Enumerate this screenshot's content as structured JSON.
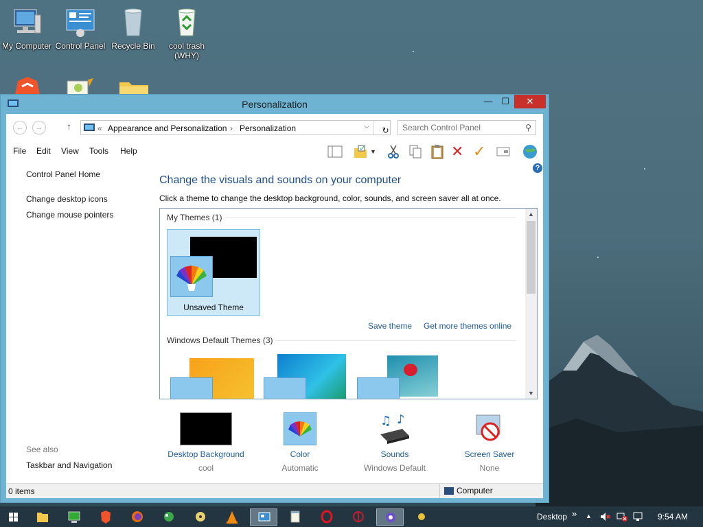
{
  "desktop": {
    "icons": [
      {
        "label": "My Computer"
      },
      {
        "label": "Control Panel"
      },
      {
        "label": "Recycle Bin"
      },
      {
        "label": "cool trash (WHY)"
      }
    ]
  },
  "window": {
    "title": "Personalization",
    "controls": {
      "minimize": "—",
      "maximize": "☐",
      "close": "✕"
    },
    "address": {
      "prefix": "«",
      "crumb1": "Appearance and Personalization",
      "sep": "›",
      "crumb2": "Personalization"
    },
    "search": {
      "placeholder": "Search Control Panel"
    },
    "menu": [
      "File",
      "Edit",
      "View",
      "Tools",
      "Help"
    ],
    "sidebar": {
      "home": "Control Panel Home",
      "links": [
        "Change desktop icons",
        "Change mouse pointers"
      ],
      "see_also": "See also",
      "see_also_links": [
        "Taskbar and Navigation"
      ]
    },
    "main": {
      "heading": "Change the visuals and sounds on your computer",
      "description": "Click a theme to change the desktop background, color, sounds, and screen saver all at once.",
      "my_themes_label": "My Themes (1)",
      "selected_theme": "Unsaved Theme",
      "save_theme": "Save theme",
      "get_more": "Get more themes online",
      "default_themes_label": "Windows Default Themes (3)"
    },
    "bottom": [
      {
        "label": "Desktop Background",
        "value": "cool"
      },
      {
        "label": "Color",
        "value": "Automatic"
      },
      {
        "label": "Sounds",
        "value": "Windows Default"
      },
      {
        "label": "Screen Saver",
        "value": "None"
      }
    ],
    "status": {
      "items": "0 items",
      "location": "Computer"
    }
  },
  "taskbar": {
    "desktop_label": "Desktop",
    "chevron": "»",
    "clock": "9:54 AM"
  },
  "colors": {
    "accent": "#6fb3d2",
    "link": "#1e5d9e",
    "heading": "#1e4e8c",
    "close": "#c7302b"
  }
}
